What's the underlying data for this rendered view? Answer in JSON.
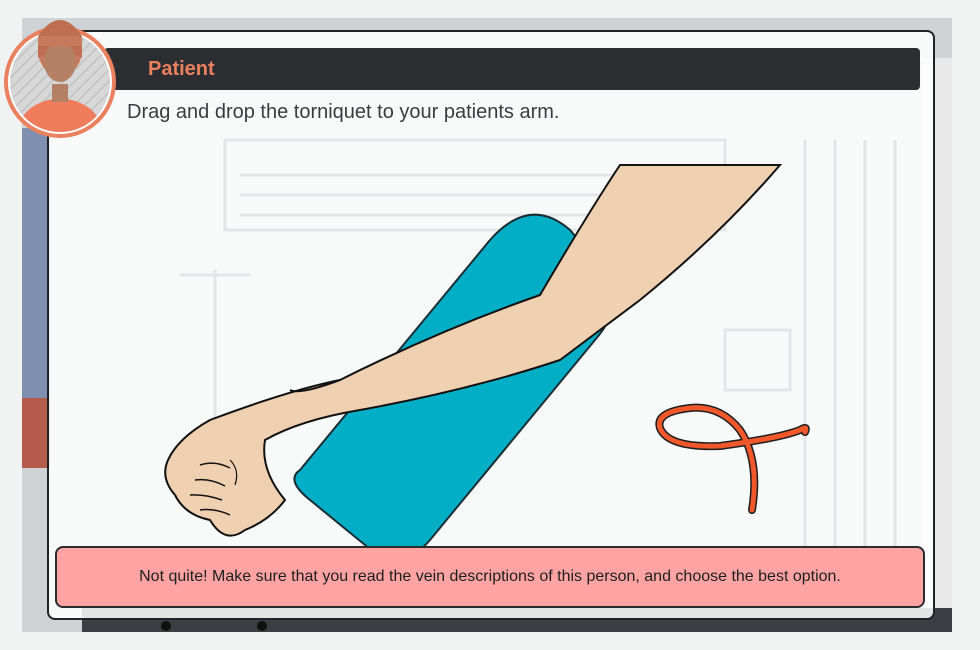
{
  "dialog": {
    "speaker": "Patient",
    "instruction": "Drag and drop the torniquet to your patients arm."
  },
  "feedback": {
    "message": "Not quite! Make sure that you read the vein descriptions of this person, and choose the best option."
  },
  "icons": {
    "avatar": "patient-avatar-icon",
    "tourniquet": "tourniquet-icon",
    "arm": "patient-arm-icon",
    "arm_rest": "arm-rest-pad-icon"
  },
  "colors": {
    "title_accent": "#e9805e",
    "feedback_bg": "#ffa3a3",
    "arm_rest": "#00aec6",
    "tourniquet": "#f0582b",
    "skin": "#efd0b1"
  }
}
